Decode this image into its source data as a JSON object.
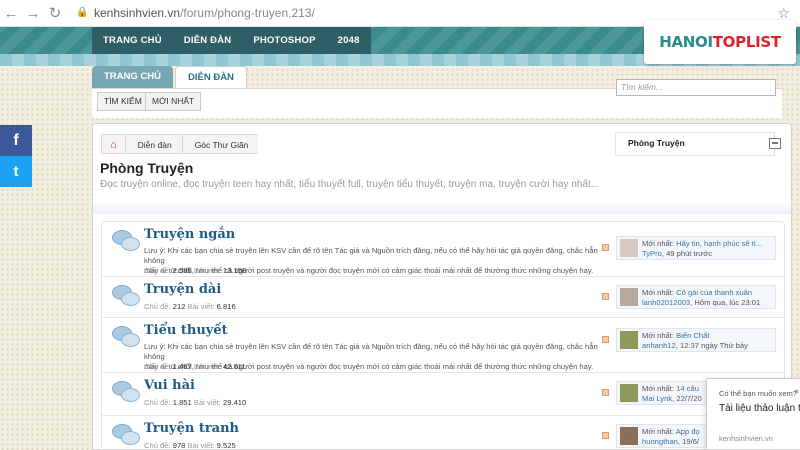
{
  "browser": {
    "url_host": "kenhsinhvien.vn",
    "url_path": "/forum/phong-truyen.213/"
  },
  "header": {
    "nav": [
      "TRANG CHỦ",
      "DIỄN ĐÀN",
      "PHOTOSHOP",
      "2048"
    ],
    "logo_left": "HANOI",
    "logo_right": "TOPLIST"
  },
  "tabs": {
    "home": "TRANG CHỦ",
    "forum": "DIỄN ĐÀN"
  },
  "subnav": {
    "search": "TÌM KIẾM",
    "newest": "MỚI NHẤT"
  },
  "search": {
    "placeholder": "Tìm kiếm..."
  },
  "social": {
    "facebook": "f",
    "twitter": "t"
  },
  "breadcrumb": {
    "home_icon": "home-icon",
    "items": [
      "Diễn đàn",
      "Góc Thư Giãn",
      "Phòng Truyện"
    ]
  },
  "page": {
    "title": "Phòng Truyện",
    "description": "Đọc truyện online, đọc truyện teen hay nhất, tiểu thuyết full, truyện tiểu thuyết, truyện ma, truyện cười hay nhất..."
  },
  "nodes": [
    {
      "name": "Truyện ngắn",
      "note_lines": [
        "Lưu ý: Khi các bạn chia sẻ truyện lên KSV cần để rõ tên Tác giả và Nguồn trích đăng, nếu có thể hãy hỏi tác giả quyền đăng, chắc hẳn không",
        "mấy ai từ chối, như thế cả người post truyện và người đọc truyện mới có cảm giác thoải mái nhất để thưởng thức những chuyện hay."
      ],
      "topics_label": "Chủ đề:",
      "topics": "2.586",
      "posts_label": "Bài viết:",
      "posts": "13.158",
      "latest_label": "Mới nhất:",
      "latest_title": "Hãy tin, hạnh phúc sẽ tì...",
      "latest_by": "TyPro",
      "latest_time": "49 phút trước"
    },
    {
      "name": "Truyện dài",
      "note_lines": [],
      "topics_label": "Chủ đề:",
      "topics": "212",
      "posts_label": "Bài viết:",
      "posts": "6.816",
      "latest_label": "Mới nhất:",
      "latest_title": "Cô gái của thanh xuân",
      "latest_by": "lanh02012003",
      "latest_time": "Hôm qua, lúc 23:01"
    },
    {
      "name": "Tiểu thuyết",
      "note_lines": [
        "Lưu ý: Khi các bạn chia sẻ truyện lên KSV cần để rõ tên Tác giả và Nguồn trích đăng, nếu có thể hãy hỏi tác giả quyền đăng, chắc hẳn không",
        "mấy ai từ chối, như thế cả người post truyện và người đọc truyện mới có cảm giác thoải mái nhất để thưởng thức những chuyện hay."
      ],
      "topics_label": "Chủ đề:",
      "topics": "1.467",
      "posts_label": "Bài viết:",
      "posts": "42.011",
      "latest_label": "Mới nhất:",
      "latest_title": "Biến Chất",
      "latest_by": "anhanh12",
      "latest_time": "12:37 ngày Thứ bảy"
    },
    {
      "name": "Vui hài",
      "note_lines": [],
      "topics_label": "Chủ đề:",
      "topics": "1.851",
      "posts_label": "Bài viết:",
      "posts": "29.410",
      "latest_label": "Mới nhất:",
      "latest_title": "14 câu",
      "latest_by": "Mai Lynk",
      "latest_time": "22/7/20"
    },
    {
      "name": "Truyện tranh",
      "note_lines": [],
      "topics_label": "Chủ đề:",
      "topics": "978",
      "posts_label": "Bài viết:",
      "posts": "9.525",
      "latest_label": "Mới nhất:",
      "latest_title": "App đọ",
      "latest_by": "huongthan",
      "latest_time": "19/6/"
    }
  ],
  "popup": {
    "question": "Có thể bạn muốn xem?",
    "title": "Tài liệu thảo luận tr",
    "domain": "kenhsinhvien.vn"
  }
}
